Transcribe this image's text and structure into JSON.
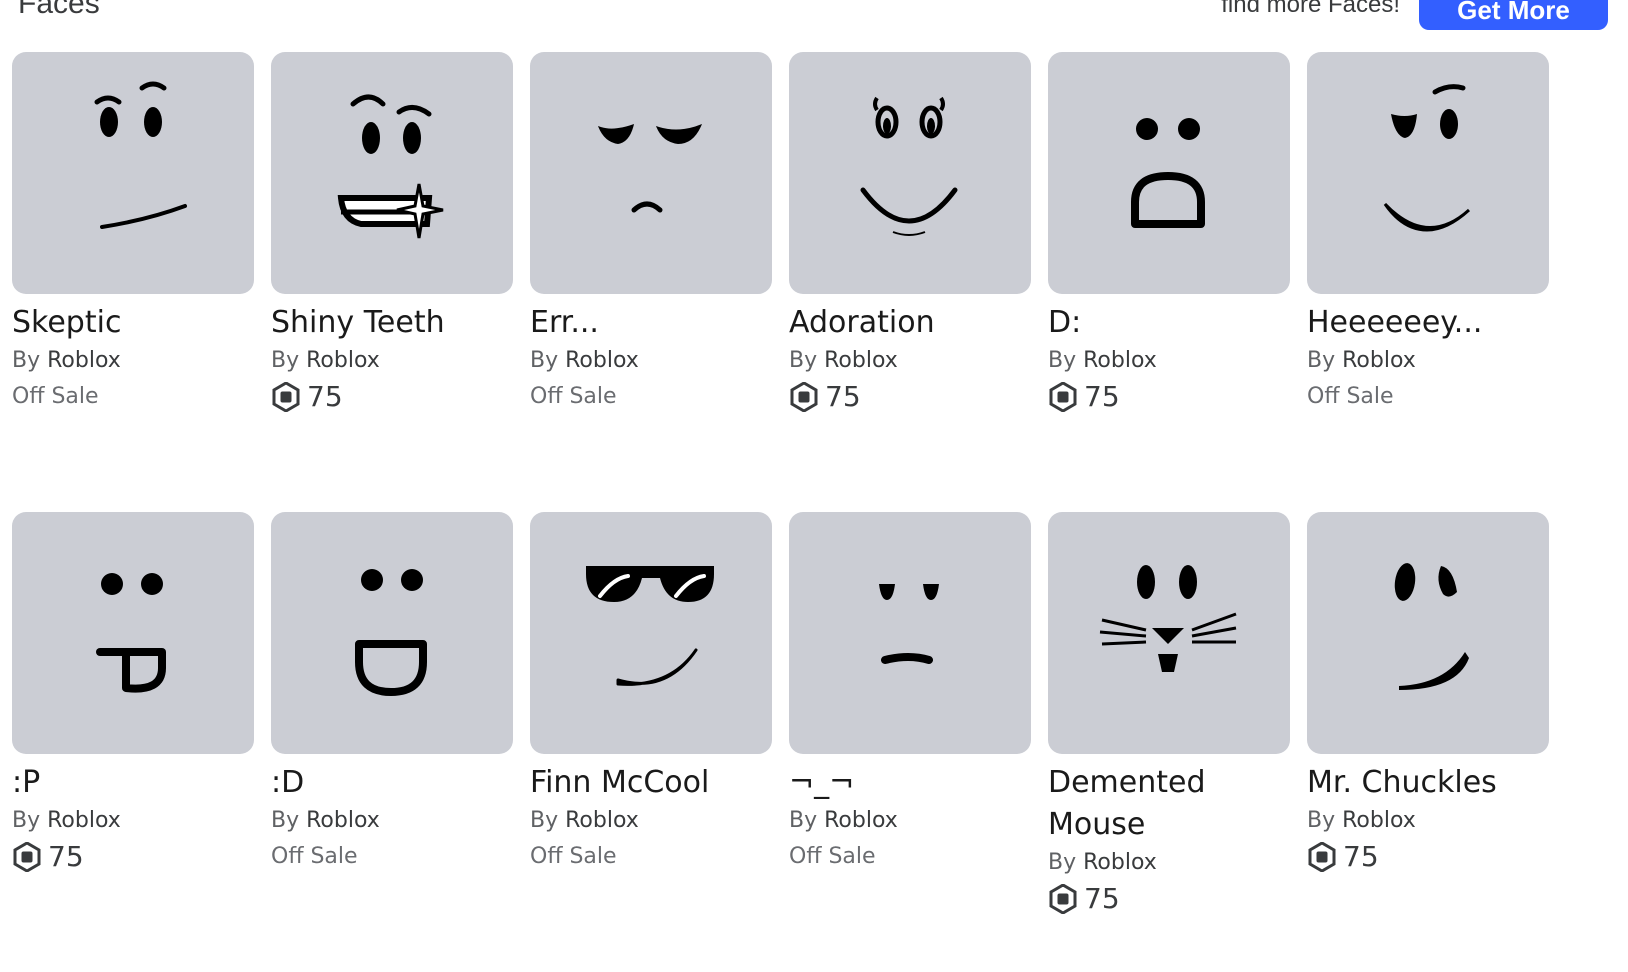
{
  "header": {
    "section_title": "Faces",
    "find_more_text": "find more Faces!",
    "get_more_label": "Get More"
  },
  "items": [
    {
      "name": "Skeptic",
      "by": "By",
      "creator": "Roblox",
      "price_status": "Off Sale",
      "price": null,
      "face_icon": "skeptic-face-icon"
    },
    {
      "name": "Shiny Teeth",
      "by": "By",
      "creator": "Roblox",
      "price_status": null,
      "price": "75",
      "face_icon": "shiny-teeth-face-icon"
    },
    {
      "name": "Err...",
      "by": "By",
      "creator": "Roblox",
      "price_status": "Off Sale",
      "price": null,
      "face_icon": "err-face-icon"
    },
    {
      "name": "Adoration",
      "by": "By",
      "creator": "Roblox",
      "price_status": null,
      "price": "75",
      "face_icon": "adoration-face-icon"
    },
    {
      "name": "D:",
      "by": "By",
      "creator": "Roblox",
      "price_status": null,
      "price": "75",
      "face_icon": "d-face-icon"
    },
    {
      "name": "Heeeeeey...",
      "by": "By",
      "creator": "Roblox",
      "price_status": "Off Sale",
      "price": null,
      "face_icon": "heeeeeey-face-icon"
    },
    {
      "name": ":P",
      "by": "By",
      "creator": "Roblox",
      "price_status": null,
      "price": "75",
      "face_icon": "tongue-face-icon"
    },
    {
      "name": ":D",
      "by": "By",
      "creator": "Roblox",
      "price_status": "Off Sale",
      "price": null,
      "face_icon": "grin-face-icon"
    },
    {
      "name": "Finn McCool",
      "by": "By",
      "creator": "Roblox",
      "price_status": "Off Sale",
      "price": null,
      "face_icon": "sunglasses-face-icon"
    },
    {
      "name": "¬_¬",
      "by": "By",
      "creator": "Roblox",
      "price_status": "Off Sale",
      "price": null,
      "face_icon": "unimpressed-face-icon"
    },
    {
      "name": "Demented Mouse",
      "by": "By",
      "creator": "Roblox",
      "price_status": null,
      "price": "75",
      "face_icon": "mouse-face-icon"
    },
    {
      "name": "Mr. Chuckles",
      "by": "By",
      "creator": "Roblox",
      "price_status": null,
      "price": "75",
      "face_icon": "chuckles-face-icon"
    }
  ],
  "colors": {
    "thumbnail_bg": "#cbcdd4",
    "button_blue": "#335fff",
    "secondary_text": "#6a6c70"
  },
  "icons": {
    "currency": "robux-icon"
  }
}
